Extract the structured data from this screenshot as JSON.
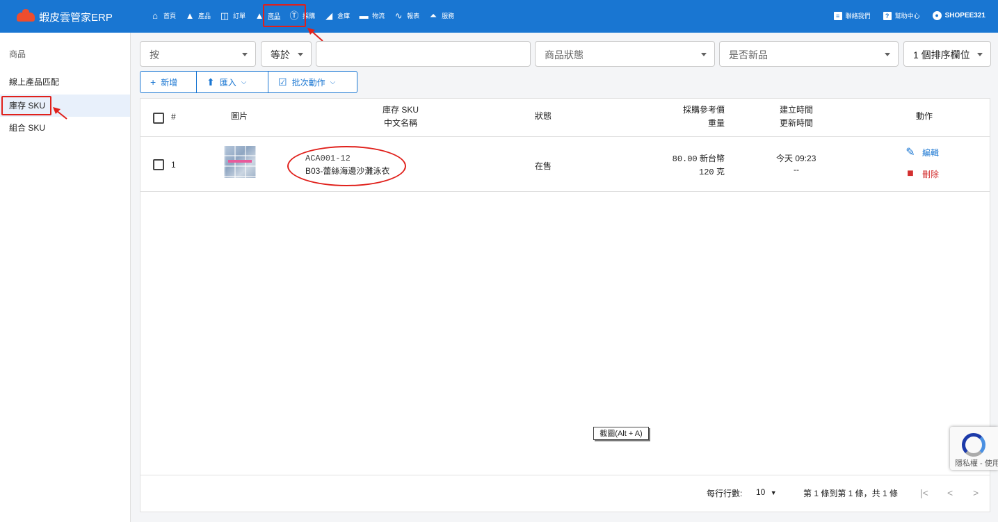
{
  "app": {
    "title": "蝦皮雲管家ERP",
    "logo_text": "Shopee 321"
  },
  "nav": [
    {
      "label": "首頁",
      "icon": "home-icon"
    },
    {
      "label": "產品",
      "icon": "bag-icon"
    },
    {
      "label": "訂單",
      "icon": "cart-icon"
    },
    {
      "label": "商品",
      "icon": "shapes-icon"
    },
    {
      "label": "採購",
      "icon": "dollar-icon"
    },
    {
      "label": "倉庫",
      "icon": "warehouse-icon"
    },
    {
      "label": "物流",
      "icon": "truck-icon"
    },
    {
      "label": "報表",
      "icon": "chart-icon"
    },
    {
      "label": "服務",
      "icon": "bell-icon"
    }
  ],
  "right_nav": {
    "contact": "聯絡我們",
    "help": "幫助中心",
    "user": "SHOPEE321"
  },
  "sidebar": {
    "header": "商品",
    "items": [
      "線上產品匹配",
      "庫存 SKU",
      "組合 SKU"
    ]
  },
  "filters": {
    "field": "按",
    "operator": "等於",
    "value": "",
    "status": "商品狀態",
    "is_new": "是否新品",
    "sort": "1 個排序欄位"
  },
  "actions": {
    "add": "新增",
    "import": "匯入",
    "batch": "批次動作"
  },
  "table": {
    "headers": {
      "index": "#",
      "image": "圖片",
      "sku_line1": "庫存 SKU",
      "sku_line2": "中文名稱",
      "status": "狀態",
      "price_line1": "採購參考價",
      "price_line2": "重量",
      "time_line1": "建立時間",
      "time_line2": "更新時間",
      "actions": "動作"
    },
    "rows": [
      {
        "index": "1",
        "sku": "ACA001-12",
        "name": "B03-蕾絲海邊沙灘泳衣",
        "status": "在售",
        "price_value": "80.00",
        "price_unit": "新台幣",
        "weight_value": "120",
        "weight_unit": "克",
        "created": "今天 09:23",
        "updated": "--",
        "edit": "編輯",
        "delete": "刪除"
      }
    ]
  },
  "pagination": {
    "rows_label": "每行行數:",
    "rows_value": "10",
    "range": "第 1 條到第 1 條，共 1 條"
  },
  "tooltip": "截圖(Alt + A)",
  "recaptcha": {
    "text": "隱私權 - 使用條款"
  }
}
